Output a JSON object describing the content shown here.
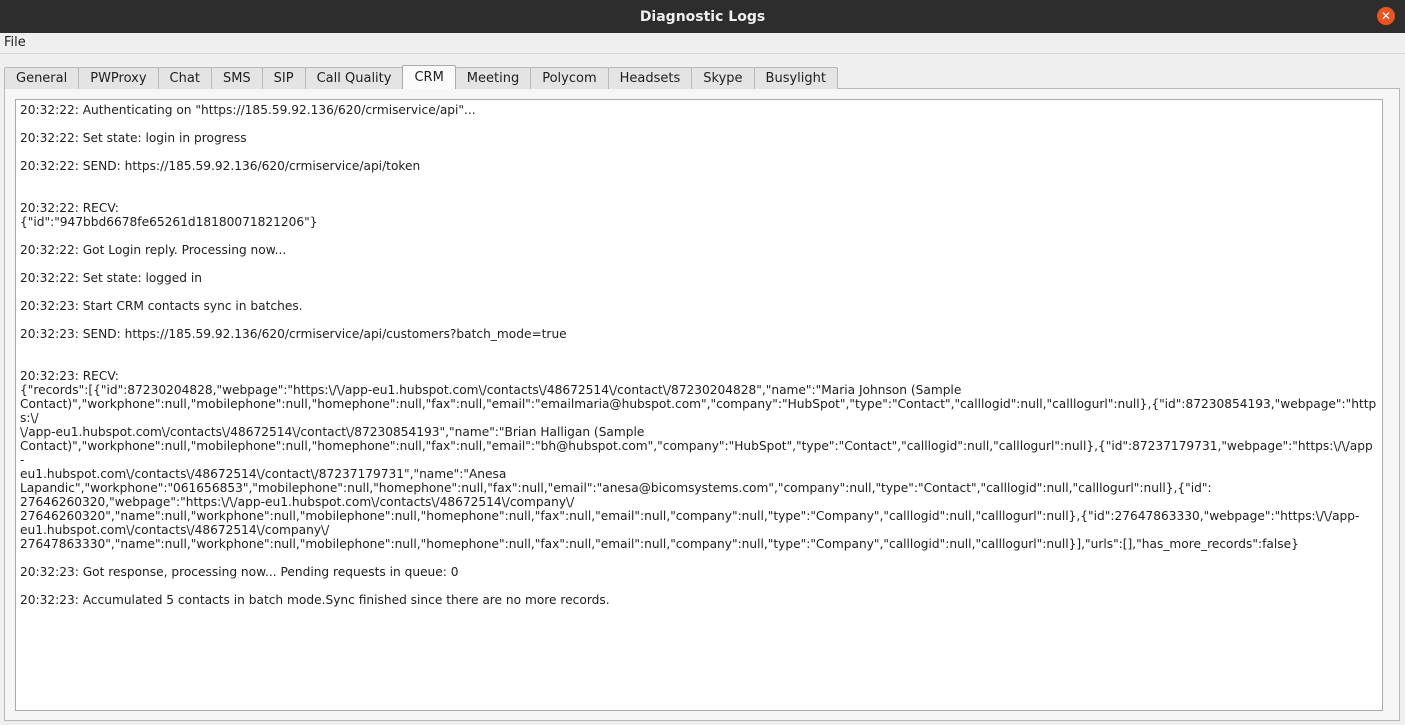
{
  "window": {
    "title": "Diagnostic Logs",
    "close_icon": "close-icon"
  },
  "menu": {
    "file": "File"
  },
  "tabs": [
    {
      "label": "General"
    },
    {
      "label": "PWProxy"
    },
    {
      "label": "Chat"
    },
    {
      "label": "SMS"
    },
    {
      "label": "SIP"
    },
    {
      "label": "Call Quality"
    },
    {
      "label": "CRM",
      "active": true
    },
    {
      "label": "Meeting"
    },
    {
      "label": "Polycom"
    },
    {
      "label": "Headsets"
    },
    {
      "label": "Skype"
    },
    {
      "label": "Busylight"
    }
  ],
  "log": [
    "20:32:22: Authenticating on \"https://185.59.92.136/620/crmiservice/api\"...",
    "20:32:22: Set state: login in progress",
    "20:32:22: SEND: https://185.59.92.136/620/crmiservice/api/token",
    "20:32:22: RECV:\n{\"id\":\"947bbd6678fe65261d18180071821206\"}",
    "20:32:22: Got Login reply. Processing now...",
    "20:32:22: Set state: logged in",
    "20:32:23: Start CRM contacts sync in batches.",
    "20:32:23: SEND: https://185.59.92.136/620/crmiservice/api/customers?batch_mode=true",
    "20:32:23: RECV:\n{\"records\":[{\"id\":87230204828,\"webpage\":\"https:\\/\\/app-eu1.hubspot.com\\/contacts\\/48672514\\/contact\\/87230204828\",\"name\":\"Maria Johnson (Sample\nContact)\",\"workphone\":null,\"mobilephone\":null,\"homephone\":null,\"fax\":null,\"email\":\"emailmaria@hubspot.com\",\"company\":\"HubSpot\",\"type\":\"Contact\",\"calllogid\":null,\"calllogurl\":null},{\"id\":87230854193,\"webpage\":\"https:\\/\n\\/app-eu1.hubspot.com\\/contacts\\/48672514\\/contact\\/87230854193\",\"name\":\"Brian Halligan (Sample\nContact)\",\"workphone\":null,\"mobilephone\":null,\"homephone\":null,\"fax\":null,\"email\":\"bh@hubspot.com\",\"company\":\"HubSpot\",\"type\":\"Contact\",\"calllogid\":null,\"calllogurl\":null},{\"id\":87237179731,\"webpage\":\"https:\\/\\/app-\neu1.hubspot.com\\/contacts\\/48672514\\/contact\\/87237179731\",\"name\":\"Anesa\nLapandic\",\"workphone\":\"061656853\",\"mobilephone\":null,\"homephone\":null,\"fax\":null,\"email\":\"anesa@bicomsystems.com\",\"company\":null,\"type\":\"Contact\",\"calllogid\":null,\"calllogurl\":null},{\"id\":\n27646260320,\"webpage\":\"https:\\/\\/app-eu1.hubspot.com\\/contacts\\/48672514\\/company\\/\n27646260320\",\"name\":null,\"workphone\":null,\"mobilephone\":null,\"homephone\":null,\"fax\":null,\"email\":null,\"company\":null,\"type\":\"Company\",\"calllogid\":null,\"calllogurl\":null},{\"id\":27647863330,\"webpage\":\"https:\\/\\/app-\neu1.hubspot.com\\/contacts\\/48672514\\/company\\/\n27647863330\",\"name\":null,\"workphone\":null,\"mobilephone\":null,\"homephone\":null,\"fax\":null,\"email\":null,\"company\":null,\"type\":\"Company\",\"calllogid\":null,\"calllogurl\":null}],\"urls\":[],\"has_more_records\":false}",
    "20:32:23: Got response, processing now... Pending requests in queue: 0",
    "20:32:23: Accumulated 5 contacts in batch mode.Sync finished since there are no more records."
  ]
}
